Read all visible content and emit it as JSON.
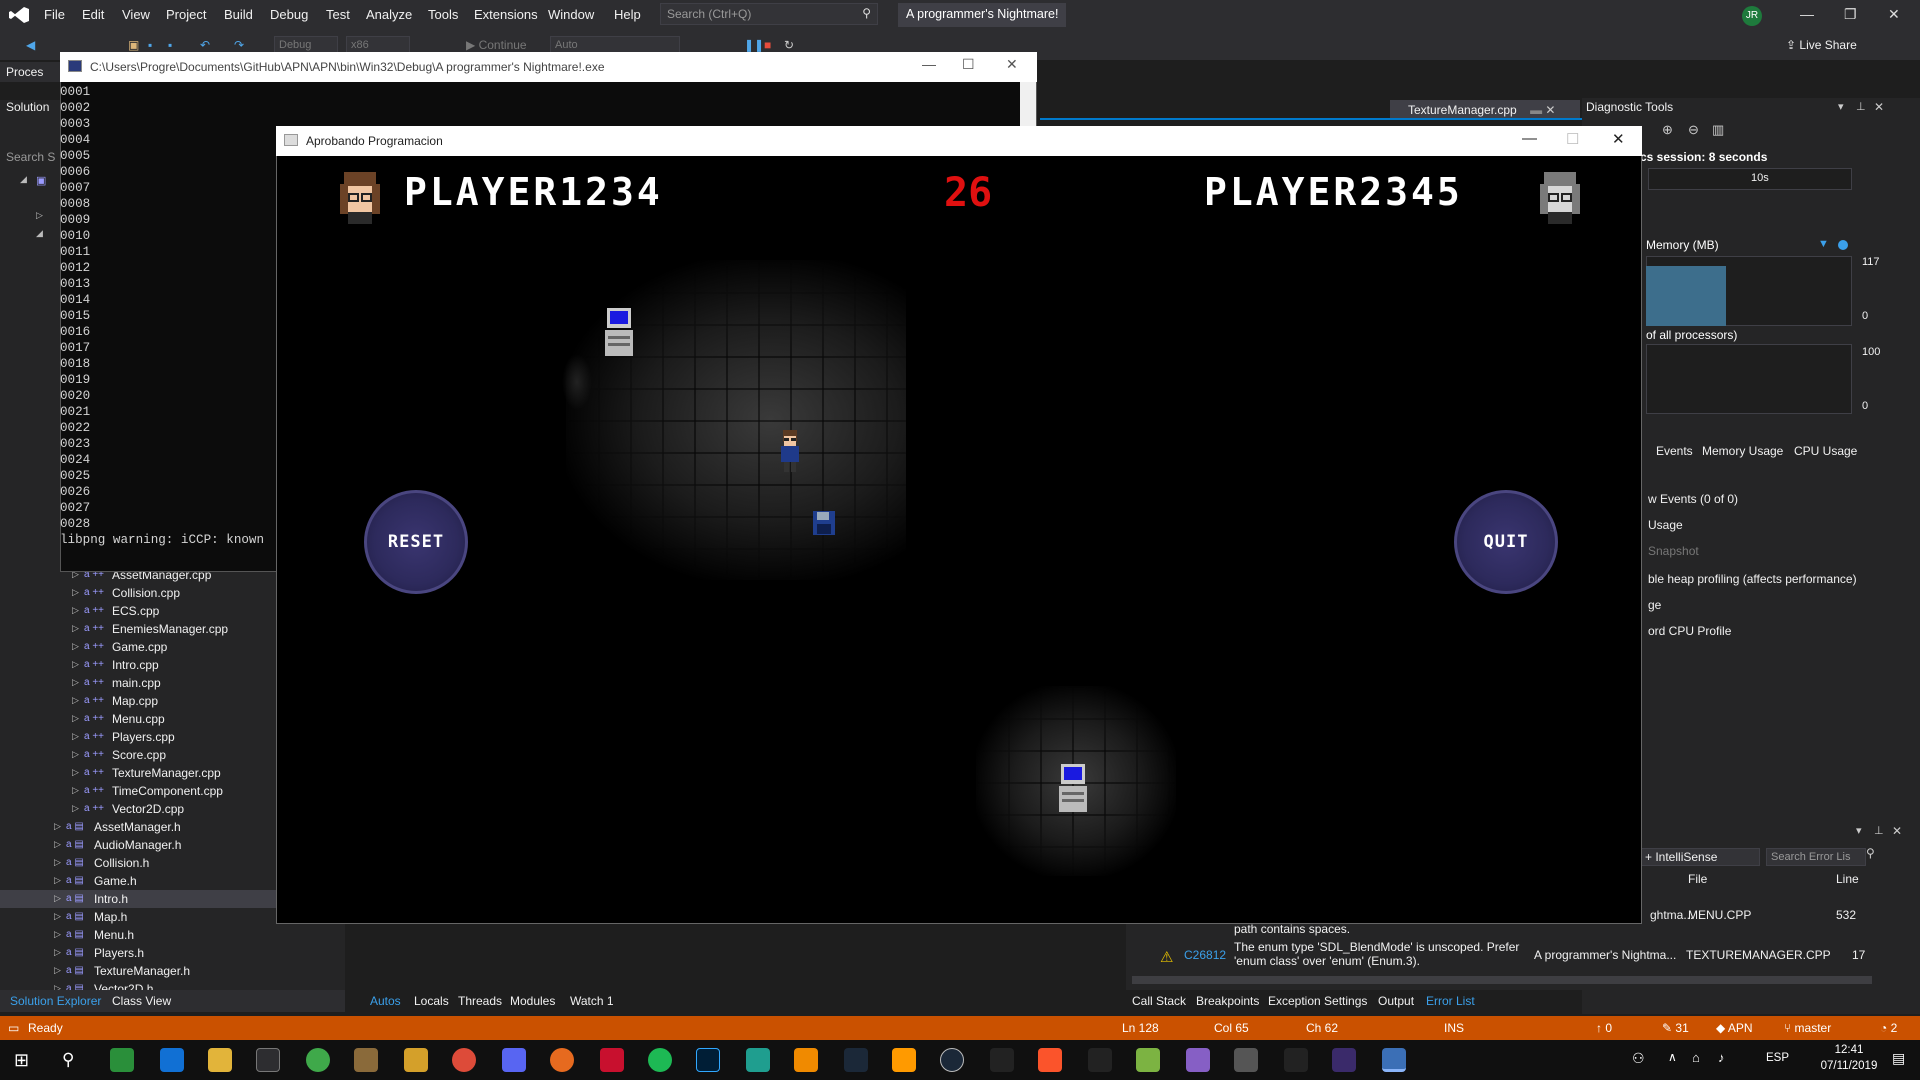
{
  "menubar": {
    "items": [
      "File",
      "Edit",
      "View",
      "Project",
      "Build",
      "Debug",
      "Test",
      "Analyze",
      "Tools",
      "Extensions",
      "Window",
      "Help"
    ],
    "search_placeholder": "Search (Ctrl+Q)",
    "solution_title": "A programmer's Nightmare!",
    "user_initials": "JR"
  },
  "toolbar": {
    "config": "Debug",
    "platform": "x86",
    "continue_label": "Continue",
    "auto_label": "Auto",
    "live_share": "Live Share"
  },
  "left_panel": {
    "tab_label": "Proces",
    "header": "Solution",
    "search_label": "Search S"
  },
  "console": {
    "title": "C:\\Users\\Progre\\Documents\\GitHub\\APN\\APN\\bin\\Win32\\Debug\\A programmer's Nightmare!.exe",
    "lines": [
      "0001",
      "0002",
      "0003",
      "0004",
      "0005",
      "0006",
      "0007",
      "0008",
      "0009",
      "0010",
      "0011",
      "0012",
      "0013",
      "0014",
      "0015",
      "0016",
      "0017",
      "0018",
      "0019",
      "0020",
      "0021",
      "0022",
      "0023",
      "0024",
      "0025",
      "0026",
      "0027",
      "0028"
    ],
    "warning": "libpng warning: iCCP: known"
  },
  "solution_tree": {
    "cpp_files": [
      "AssetManager.cpp",
      "Collision.cpp",
      "ECS.cpp",
      "EnemiesManager.cpp",
      "Game.cpp",
      "Intro.cpp",
      "main.cpp",
      "Map.cpp",
      "Menu.cpp",
      "Players.cpp",
      "Score.cpp",
      "TextureManager.cpp",
      "TimeComponent.cpp",
      "Vector2D.cpp"
    ],
    "h_files": [
      "AssetManager.h",
      "AudioManager.h",
      "Collision.h",
      "Game.h",
      "Intro.h",
      "Map.h",
      "Menu.h",
      "Players.h",
      "TextureManager.h",
      "Vector2D.h"
    ],
    "selected": "Intro.h",
    "tabs": [
      "Solution Explorer",
      "Class View"
    ]
  },
  "editor": {
    "tab_label": "TextureManager.cpp"
  },
  "diagnostics": {
    "header": "Diagnostic Tools",
    "session": "cs session: 8 seconds",
    "timeline_label": "10s",
    "memory_label": "Memory (MB)",
    "memory_max": "117",
    "memory_min": "0",
    "cpu_label": "of all processors)",
    "cpu_max": "100",
    "cpu_min": "0",
    "tabs": [
      "Events",
      "Memory Usage",
      "CPU Usage"
    ],
    "events_line": "w Events (0 of 0)",
    "usage_line": "Usage",
    "snapshot_line": "Snapshot",
    "heap_line": "ble heap profiling (affects performance)",
    "ge_line": "ge",
    "cpu_profile_line": "ord CPU Profile"
  },
  "error_list": {
    "filter": "+ IntelliSense",
    "search_placeholder": "Search Error Lis",
    "col_file": "File",
    "col_line": "Line",
    "row1": {
      "project": "ghtma...",
      "file": "MENU.CPP",
      "line": "532"
    },
    "row2_desc_prev": "path contains spaces.",
    "row2": {
      "code": "C26812",
      "desc": "The enum type 'SDL_BlendMode' is unscoped. Prefer 'enum class' over 'enum' (Enum.3).",
      "project": "A programmer's Nightma...",
      "file": "TEXTUREMANAGER.CPP",
      "line": "17"
    }
  },
  "bottom_tabs": {
    "debug": [
      "Autos",
      "Locals",
      "Threads",
      "Modules",
      "Watch 1"
    ],
    "tools": [
      "Call Stack",
      "Breakpoints",
      "Exception Settings",
      "Output",
      "Error List"
    ]
  },
  "statusbar": {
    "ready": "Ready",
    "ln": "Ln 128",
    "col": "Col 65",
    "ch": "Ch 62",
    "ins": "INS",
    "errors": "0",
    "changes": "31",
    "repo": "APN",
    "branch": "master",
    "notif": "2"
  },
  "taskbar": {
    "lang": "ESP",
    "time": "12:41",
    "date": "07/11/2019"
  },
  "game": {
    "window_title": "Aprobando Programacion",
    "player1": "PLAYER1234",
    "player2": "PLAYER2345",
    "score": "26",
    "reset_label": "RESET",
    "quit_label": "QUIT"
  }
}
